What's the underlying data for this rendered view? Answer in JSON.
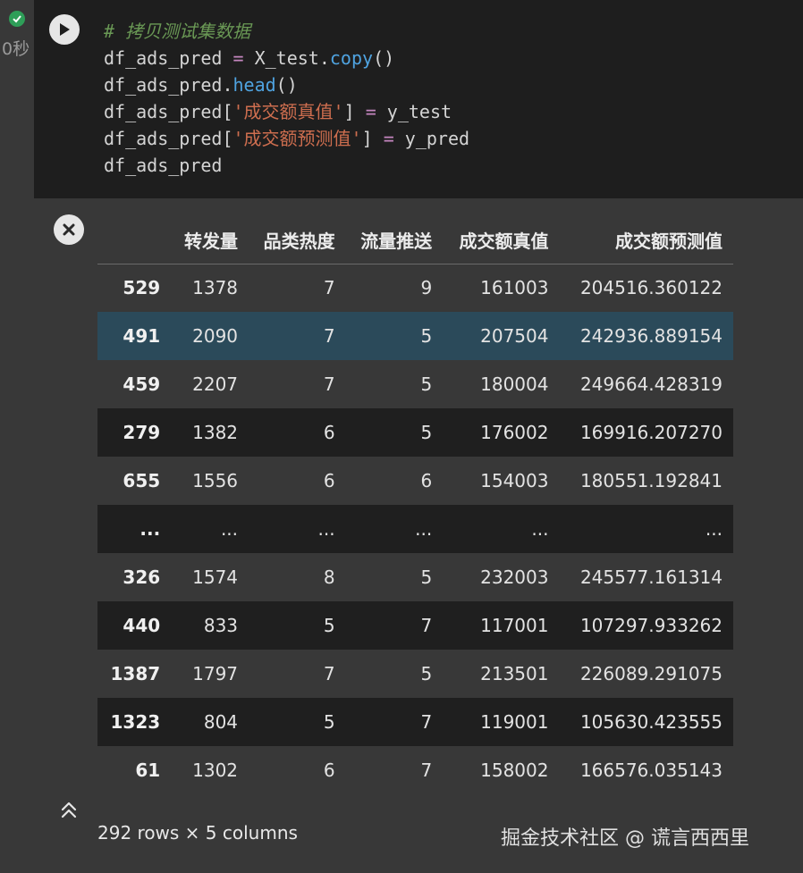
{
  "cell": {
    "exec_time": "0秒",
    "code_lines": {
      "comment": "# 拷贝测试集数据",
      "l2_var": "df_ads_pred",
      "l2_eq": "=",
      "l2_obj": "X_test.",
      "l2_fn": "copy",
      "l2_paren": "()",
      "l3_obj": "df_ads_pred.",
      "l3_fn": "head",
      "l3_paren": "()",
      "l4_a": "df_ads_pred[",
      "l4_str": "'成交额真值'",
      "l4_b": "]",
      "l4_eq": "=",
      "l4_c": "y_test",
      "l5_a": "df_ads_pred[",
      "l5_str": "'成交额预测值'",
      "l5_b": "]",
      "l5_eq": "=",
      "l5_c": "y_pred",
      "l6": "df_ads_pred"
    }
  },
  "table": {
    "columns": [
      "",
      "转发量",
      "品类热度",
      "流量推送",
      "成交额真值",
      "成交额预测值"
    ],
    "rows": [
      [
        "529",
        "1378",
        "7",
        "9",
        "161003",
        "204516.360122"
      ],
      [
        "491",
        "2090",
        "7",
        "5",
        "207504",
        "242936.889154"
      ],
      [
        "459",
        "2207",
        "7",
        "5",
        "180004",
        "249664.428319"
      ],
      [
        "279",
        "1382",
        "6",
        "5",
        "176002",
        "169916.207270"
      ],
      [
        "655",
        "1556",
        "6",
        "6",
        "154003",
        "180551.192841"
      ],
      [
        "...",
        "...",
        "...",
        "...",
        "...",
        "..."
      ],
      [
        "326",
        "1574",
        "8",
        "5",
        "232003",
        "245577.161314"
      ],
      [
        "440",
        "833",
        "5",
        "7",
        "117001",
        "107297.933262"
      ],
      [
        "1387",
        "1797",
        "7",
        "5",
        "213501",
        "226089.291075"
      ],
      [
        "1323",
        "804",
        "5",
        "7",
        "119001",
        "105630.423555"
      ],
      [
        "61",
        "1302",
        "6",
        "7",
        "158002",
        "166576.035143"
      ]
    ]
  },
  "shape_text": "292 rows × 5 columns",
  "watermark": "掘金技术社区 @ 谎言西西里",
  "icons": {
    "status": "check-circle-icon",
    "run": "play-icon",
    "clear": "close-circle-icon",
    "collapse": "chevrons-up-icon"
  },
  "colors": {
    "code_bg": "#1e1e1e",
    "output_bg": "#383838",
    "row_alt": "#1f1f1f",
    "row_hover": "#2b4a5a",
    "status_ok": "#2e9e58"
  }
}
